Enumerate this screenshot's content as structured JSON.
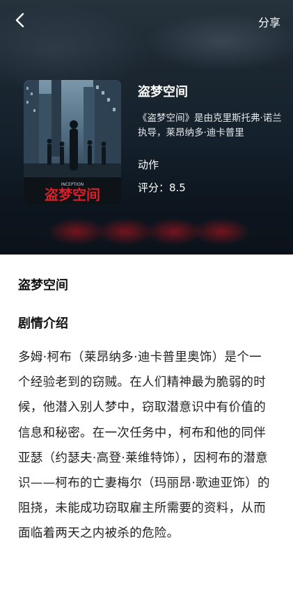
{
  "nav": {
    "back_icon": "chevron-left-icon",
    "share_label": "分享"
  },
  "movie": {
    "title": "盗梦空间",
    "description": "《盗梦空间》是由克里斯托弗·诺兰执导，莱昂纳多·迪卡普里",
    "genre": "动作",
    "rating": "评分：8.5",
    "poster_title_text": "盗梦空间",
    "poster_small_text": "INCEPTION"
  },
  "content": {
    "title": "盗梦空间",
    "section_title": "剧情介绍",
    "synopsis": "多姆·柯布（莱昂纳多·迪卡普里奥饰）是个一个经验老到的窃贼。在人们精神最为脆弱的时候，他潜入别人梦中，窃取潜意识中有价值的信息和秘密。在一次任务中，柯布和他的同伴亚瑟（约瑟夫·高登·莱维特饰），因柯布的潜意识——柯布的亡妻梅尔（玛丽昂·歌迪亚饰）的阻挠，未能成功窃取雇主所需要的资料，从而面临着两天之内被杀的危险。"
  },
  "colors": {
    "hero_bg": "#14202b",
    "accent_red": "#d8202a"
  }
}
